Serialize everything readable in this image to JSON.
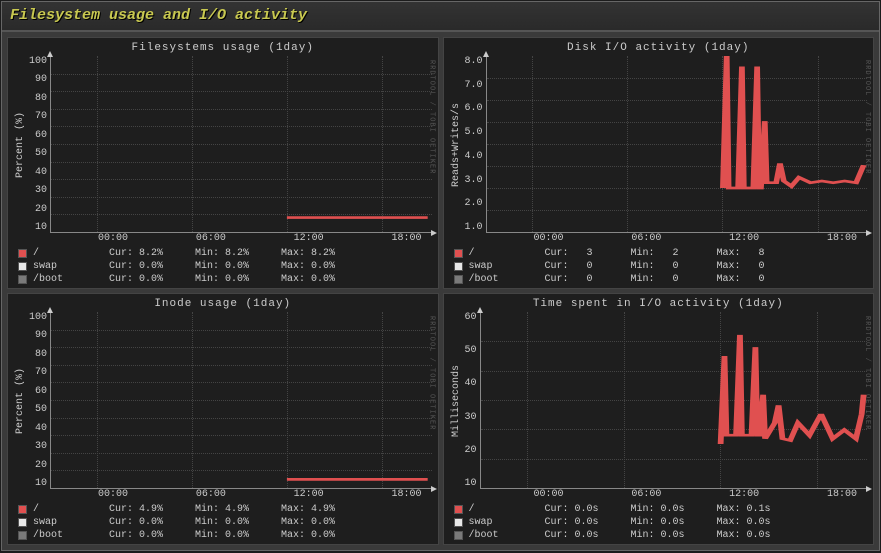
{
  "window": {
    "title": "Filesystem usage and I/O activity"
  },
  "watermark": "RRDTOOL / TOBI OETIKER",
  "xticks": [
    "00:00",
    "06:00",
    "12:00",
    "18:00"
  ],
  "series_names": {
    "root": "/",
    "swap": "swap",
    "boot": "/boot"
  },
  "stat_labels": {
    "cur": "Cur:",
    "min": "Min:",
    "max": "Max:"
  },
  "chart_data": [
    {
      "id": "fs_usage",
      "type": "line",
      "title": "Filesystems usage  (1day)",
      "ylabel": "Percent (%)",
      "yticks": [
        "100",
        "90",
        "80",
        "70",
        "60",
        "50",
        "40",
        "30",
        "20",
        "10"
      ],
      "ylim": [
        0,
        100
      ],
      "x": [
        "00:00",
        "06:00",
        "12:00",
        "18:00"
      ],
      "series": [
        {
          "name": "/",
          "color": "red",
          "values": [
            null,
            null,
            8.2,
            8.2
          ]
        },
        {
          "name": "swap",
          "color": "white",
          "values": [
            0,
            0,
            0,
            0
          ]
        },
        {
          "name": "/boot",
          "color": "gray",
          "values": [
            0,
            0,
            0,
            0
          ]
        }
      ],
      "legend": [
        {
          "name": "/",
          "swatch": "red",
          "cur": "8.2%",
          "min": "8.2%",
          "max": "8.2%"
        },
        {
          "name": "swap",
          "swatch": "white",
          "cur": "0.0%",
          "min": "0.0%",
          "max": "0.0%"
        },
        {
          "name": "/boot",
          "swatch": "gray",
          "cur": "0.0%",
          "min": "0.0%",
          "max": "0.0%"
        }
      ]
    },
    {
      "id": "disk_io",
      "type": "line",
      "title": "Disk I/O activity  (1day)",
      "ylabel": "Reads+Writes/s",
      "yticks": [
        "8.0",
        "7.0",
        "6.0",
        "5.0",
        "4.0",
        "3.0",
        "2.0",
        "1.0"
      ],
      "ylim": [
        0,
        8
      ],
      "x": [
        "00:00",
        "06:00",
        "12:00",
        "18:00"
      ],
      "series": [
        {
          "name": "/",
          "color": "red",
          "values_timeline": [
            [
              0.62,
              2
            ],
            [
              0.63,
              8
            ],
            [
              0.635,
              2
            ],
            [
              0.66,
              2
            ],
            [
              0.67,
              7.5
            ],
            [
              0.675,
              2
            ],
            [
              0.7,
              2
            ],
            [
              0.71,
              7.5
            ],
            [
              0.715,
              2
            ],
            [
              0.72,
              2
            ],
            [
              0.73,
              5
            ],
            [
              0.735,
              2.2
            ],
            [
              0.76,
              2.2
            ],
            [
              0.77,
              3.1
            ],
            [
              0.78,
              2.3
            ],
            [
              0.8,
              2.1
            ],
            [
              0.82,
              2.5
            ],
            [
              0.85,
              2.2
            ],
            [
              0.88,
              2.3
            ],
            [
              0.91,
              2.2
            ],
            [
              0.94,
              2.3
            ],
            [
              0.97,
              2.2
            ],
            [
              0.99,
              3.0
            ]
          ]
        }
      ],
      "legend": [
        {
          "name": "/",
          "swatch": "red",
          "cur": "3",
          "min": "2",
          "max": "8"
        },
        {
          "name": "swap",
          "swatch": "white",
          "cur": "0",
          "min": "0",
          "max": "0"
        },
        {
          "name": "/boot",
          "swatch": "gray",
          "cur": "0",
          "min": "0",
          "max": "0"
        }
      ]
    },
    {
      "id": "inode_usage",
      "type": "line",
      "title": "Inode usage  (1day)",
      "ylabel": "Percent (%)",
      "yticks": [
        "100",
        "90",
        "80",
        "70",
        "60",
        "50",
        "40",
        "30",
        "20",
        "10"
      ],
      "ylim": [
        0,
        100
      ],
      "x": [
        "00:00",
        "06:00",
        "12:00",
        "18:00"
      ],
      "series": [
        {
          "name": "/",
          "color": "red",
          "values": [
            null,
            null,
            4.9,
            4.9
          ]
        },
        {
          "name": "swap",
          "color": "white",
          "values": [
            0,
            0,
            0,
            0
          ]
        },
        {
          "name": "/boot",
          "color": "gray",
          "values": [
            0,
            0,
            0,
            0
          ]
        }
      ],
      "legend": [
        {
          "name": "/",
          "swatch": "red",
          "cur": "4.9%",
          "min": "4.9%",
          "max": "4.9%"
        },
        {
          "name": "swap",
          "swatch": "white",
          "cur": "0.0%",
          "min": "0.0%",
          "max": "0.0%"
        },
        {
          "name": "/boot",
          "swatch": "gray",
          "cur": "0.0%",
          "min": "0.0%",
          "max": "0.0%"
        }
      ]
    },
    {
      "id": "io_time",
      "type": "line",
      "title": "Time spent in I/O activity  (1day)",
      "ylabel": "Milliseconds",
      "yticks": [
        "60",
        "50",
        "40",
        "30",
        "20",
        "10"
      ],
      "ylim": [
        0,
        60
      ],
      "x": [
        "00:00",
        "06:00",
        "12:00",
        "18:00"
      ],
      "series": [
        {
          "name": "/",
          "color": "red",
          "values_timeline": [
            [
              0.62,
              15
            ],
            [
              0.63,
              45
            ],
            [
              0.635,
              18
            ],
            [
              0.66,
              18
            ],
            [
              0.67,
              52
            ],
            [
              0.675,
              18
            ],
            [
              0.7,
              18
            ],
            [
              0.71,
              48
            ],
            [
              0.715,
              18
            ],
            [
              0.72,
              18
            ],
            [
              0.73,
              32
            ],
            [
              0.735,
              17
            ],
            [
              0.76,
              22
            ],
            [
              0.77,
              28
            ],
            [
              0.78,
              17
            ],
            [
              0.8,
              16
            ],
            [
              0.82,
              22
            ],
            [
              0.85,
              18
            ],
            [
              0.88,
              25
            ],
            [
              0.91,
              17
            ],
            [
              0.94,
              20
            ],
            [
              0.97,
              17
            ],
            [
              0.985,
              25
            ],
            [
              0.99,
              32
            ]
          ]
        }
      ],
      "legend": [
        {
          "name": "/",
          "swatch": "red",
          "cur": "0.0s",
          "min": "0.0s",
          "max": "0.1s"
        },
        {
          "name": "swap",
          "swatch": "white",
          "cur": "0.0s",
          "min": "0.0s",
          "max": "0.0s"
        },
        {
          "name": "/boot",
          "swatch": "gray",
          "cur": "0.0s",
          "min": "0.0s",
          "max": "0.0s"
        }
      ]
    }
  ]
}
